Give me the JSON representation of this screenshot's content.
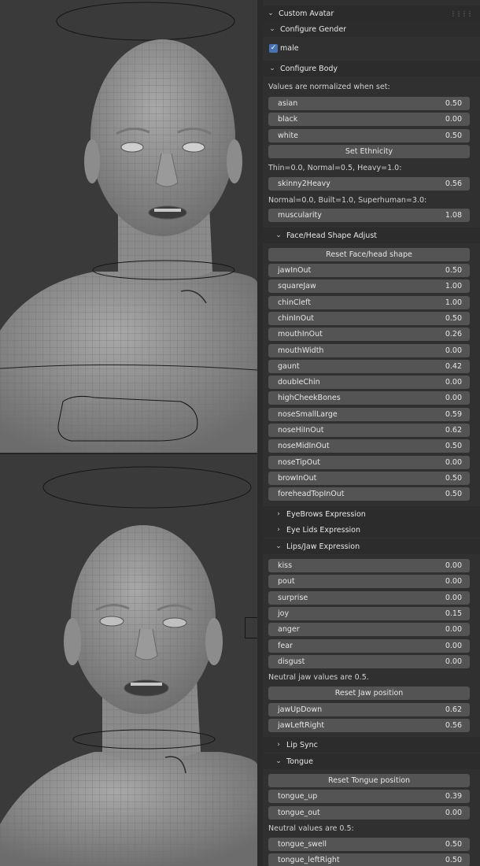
{
  "panel": {
    "title": "Custom Avatar",
    "grip_icon": "drag-grip-icon",
    "gender": {
      "title": "Configure Gender",
      "male_label": "male",
      "male_checked": true
    },
    "body": {
      "title": "Configure Body",
      "normalized_note": "Values are normalized when set:",
      "ethnicity": [
        {
          "name": "asian",
          "value": "0.50"
        },
        {
          "name": "black",
          "value": "0.00"
        },
        {
          "name": "white",
          "value": "0.50"
        }
      ],
      "set_ethnicity_label": "Set Ethnicity",
      "weight_note": "Thin=0.0, Normal=0.5, Heavy=1.0:",
      "weight": {
        "name": "skinny2Heavy",
        "value": "0.56"
      },
      "muscle_note": "Normal=0.0, Built=1.0, Superhuman=3.0:",
      "muscle": {
        "name": "muscularity",
        "value": "1.08"
      }
    },
    "face": {
      "title": "Face/Head Shape Adjust",
      "reset_label": "Reset Face/head shape",
      "sliders": [
        {
          "name": "jawInOut",
          "value": "0.50"
        },
        {
          "name": "squareJaw",
          "value": "1.00"
        },
        {
          "name": "chinCleft",
          "value": "1.00"
        },
        {
          "name": "chinInOut",
          "value": "0.50"
        },
        {
          "name": "mouthInOut",
          "value": "0.26"
        },
        {
          "name": "mouthWidth",
          "value": "0.00"
        },
        {
          "name": "gaunt",
          "value": "0.42"
        },
        {
          "name": "doubleChin",
          "value": "0.00"
        },
        {
          "name": "highCheekBones",
          "value": "0.00"
        },
        {
          "name": "noseSmallLarge",
          "value": "0.59"
        },
        {
          "name": "noseHiInOut",
          "value": "0.62"
        },
        {
          "name": "noseMidInOut",
          "value": "0.50"
        },
        {
          "name": "noseTipOut",
          "value": "0.00"
        },
        {
          "name": "browInOut",
          "value": "0.50"
        },
        {
          "name": "foreheadTopInOut",
          "value": "0.50"
        }
      ]
    },
    "eyebrows": {
      "title": "EyeBrows Expression"
    },
    "eyelids": {
      "title": "Eye Lids Expression"
    },
    "lips": {
      "title": "Lips/Jaw Expression",
      "sliders": [
        {
          "name": "kiss",
          "value": "0.00"
        },
        {
          "name": "pout",
          "value": "0.00"
        },
        {
          "name": "surprise",
          "value": "0.00"
        },
        {
          "name": "joy",
          "value": "0.15"
        },
        {
          "name": "anger",
          "value": "0.00"
        },
        {
          "name": "fear",
          "value": "0.00"
        },
        {
          "name": "disgust",
          "value": "0.00"
        }
      ],
      "jaw_note": "Neutral jaw values are 0.5.",
      "reset_jaw_label": "Reset Jaw position",
      "jaw_sliders": [
        {
          "name": "jawUpDown",
          "value": "0.62"
        },
        {
          "name": "jawLeftRight",
          "value": "0.56"
        }
      ]
    },
    "lipsync": {
      "title": "Lip Sync"
    },
    "tongue": {
      "title": "Tongue",
      "reset_label": "Reset Tongue position",
      "sliders": [
        {
          "name": "tongue_up",
          "value": "0.39"
        },
        {
          "name": "tongue_out",
          "value": "0.00"
        }
      ],
      "neutral_note": "Neutral values are 0.5:",
      "sliders2": [
        {
          "name": "tongue_swell",
          "value": "0.50"
        },
        {
          "name": "tongue_leftRight",
          "value": "0.50"
        }
      ]
    }
  },
  "icons": {
    "expanded": "chevron-down-icon",
    "collapsed": "chevron-right-icon",
    "checkbox": "checkmark-icon"
  },
  "colors": {
    "panel_bg": "#303030",
    "slider_bg": "#545454",
    "checkbox_accent": "#4772b3",
    "viewport_bg": "#3a3a3a"
  }
}
